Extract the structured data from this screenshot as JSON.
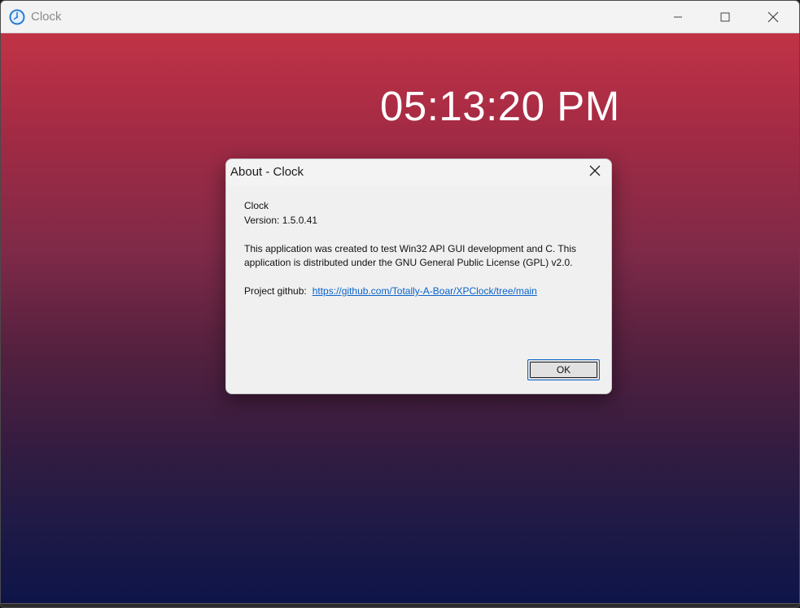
{
  "window": {
    "title": "Clock",
    "icon": "clock-icon",
    "controls": {
      "minimize": "minimize-icon",
      "maximize": "maximize-icon",
      "close": "close-icon"
    }
  },
  "clock": {
    "time": "05:13:20 PM"
  },
  "about_dialog": {
    "title": "About - Clock",
    "app_name": "Clock",
    "version": "Version: 1.5.0.41",
    "description": "This application was created to test Win32 API GUI development and C. This application is distributed under the GNU General Public License (GPL) v2.0.",
    "github_label": "Project github:",
    "github_link": "https://github.com/Totally-A-Boar/XPClock/tree/main",
    "ok_label": "OK"
  },
  "colors": {
    "gradient_top": "#c13346",
    "gradient_bottom": "#0e1448",
    "link": "#0a63c9",
    "dialog_bg": "#f0f0f0"
  }
}
